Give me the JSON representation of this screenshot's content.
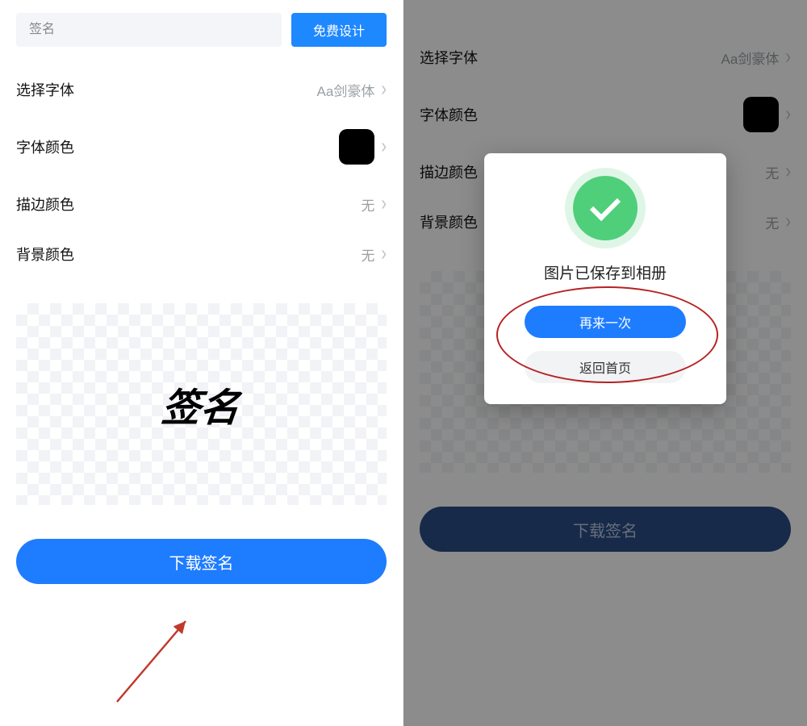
{
  "left": {
    "input_placeholder": "签名",
    "design_button": "免费设计",
    "options": {
      "font_label": "选择字体",
      "font_value": "Aa剑豪体",
      "font_color_label": "字体颜色",
      "font_color_value": "#000000",
      "stroke_color_label": "描边颜色",
      "stroke_color_value": "无",
      "bg_color_label": "背景颜色",
      "bg_color_value": "无"
    },
    "preview_text": "签名",
    "download_button": "下载签名"
  },
  "right": {
    "options": {
      "font_label": "选择字体",
      "font_value": "Aa剑豪体",
      "font_color_label": "字体颜色",
      "font_color_value": "#000000",
      "stroke_color_label": "描边颜色",
      "stroke_color_value": "无",
      "bg_color_label": "背景颜色",
      "bg_color_value": "无"
    },
    "download_button": "下载签名",
    "dialog": {
      "title": "图片已保存到相册",
      "primary": "再来一次",
      "secondary": "返回首页"
    }
  }
}
